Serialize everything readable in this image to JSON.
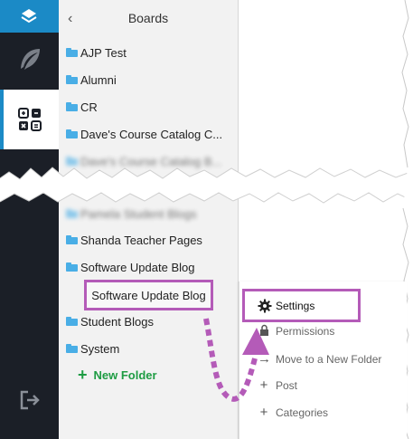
{
  "sidebar": {
    "title": "Boards",
    "back_icon": "chevron-left-icon",
    "items_top": [
      {
        "label": "AJP Test"
      },
      {
        "label": "Alumni"
      },
      {
        "label": "CR"
      },
      {
        "label": "Dave's Course Catalog C..."
      }
    ],
    "blurred_items": [
      {
        "label": "Dave's Course Catalog B..."
      },
      {
        "label": "Pamela Student Blogs"
      }
    ],
    "items_bottom": [
      {
        "label": "Shanda Teacher Pages"
      },
      {
        "label": "Software Update Blog"
      }
    ],
    "selected_sub_item": "Software Update Blog",
    "items_after": [
      {
        "label": "Student Blogs"
      },
      {
        "label": "System"
      }
    ],
    "new_folder_label": "New Folder"
  },
  "context_menu": {
    "items": [
      {
        "label": "Settings",
        "icon": "gear-icon",
        "highlighted": true
      },
      {
        "label": "Permissions",
        "icon": "lock-icon"
      },
      {
        "label": "Move to a New Folder",
        "icon": "move-icon"
      },
      {
        "label": "Post",
        "icon": "plus-icon"
      },
      {
        "label": "Categories",
        "icon": "plus-icon"
      }
    ]
  },
  "colors": {
    "rail_bg": "#1b1f27",
    "rail_accent": "#1b8ac6",
    "folder": "#49aee6",
    "highlight": "#b45bb8",
    "new_folder": "#1e9c43"
  }
}
